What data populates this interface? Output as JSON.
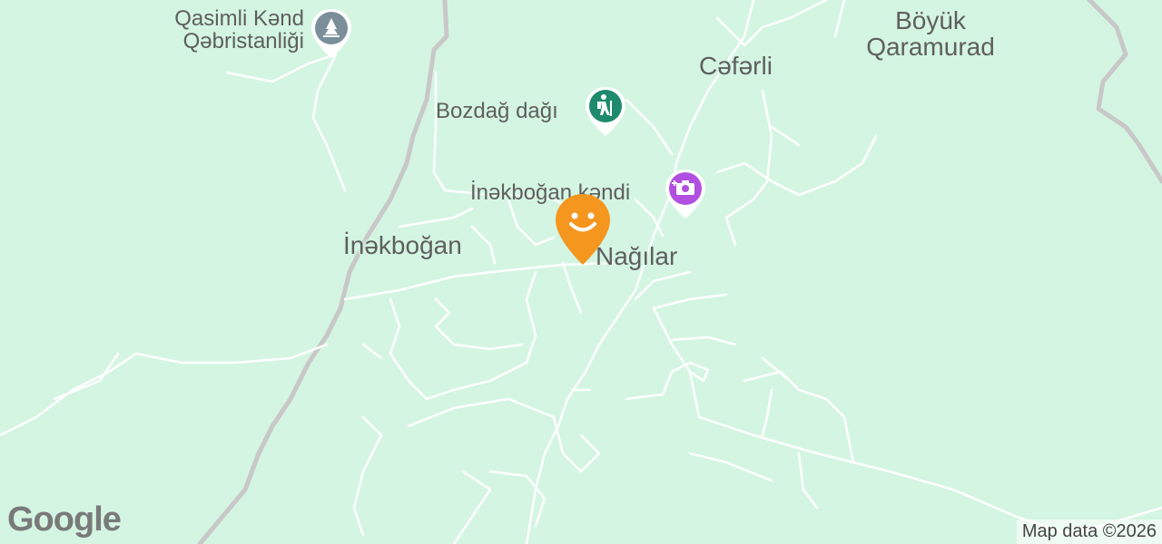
{
  "map": {
    "background_color": "#d4f5e2",
    "road_color": "#ffffff",
    "border_color": "#c9c9c9"
  },
  "places": [
    {
      "id": "inekbogan",
      "label": "İnəkboğan"
    },
    {
      "id": "nagilar",
      "label": "Nağılar"
    },
    {
      "id": "ceferli",
      "label": "Cəfərli"
    },
    {
      "id": "boyuk-qaramurad",
      "label": "Böyük\nQaramurad"
    }
  ],
  "pois": [
    {
      "id": "qasimli-cemetery",
      "label": "Qasimli Kənd\nQəbristanliği",
      "icon": "cemetery-icon",
      "color": "#7a8f9a"
    },
    {
      "id": "bozdag",
      "label": "Bozdağ dağı",
      "icon": "hiking-icon",
      "color": "#1e8a6e"
    },
    {
      "id": "inekbogan-kendi",
      "label": "İnəkboğan kəndi",
      "icon": "camera-icon",
      "color": "#b04fe0"
    }
  ],
  "marker": {
    "icon": "smiley-marker-icon",
    "color": "#f5961f"
  },
  "footer": {
    "logo": "Google",
    "attribution": "Map data ©2026"
  }
}
